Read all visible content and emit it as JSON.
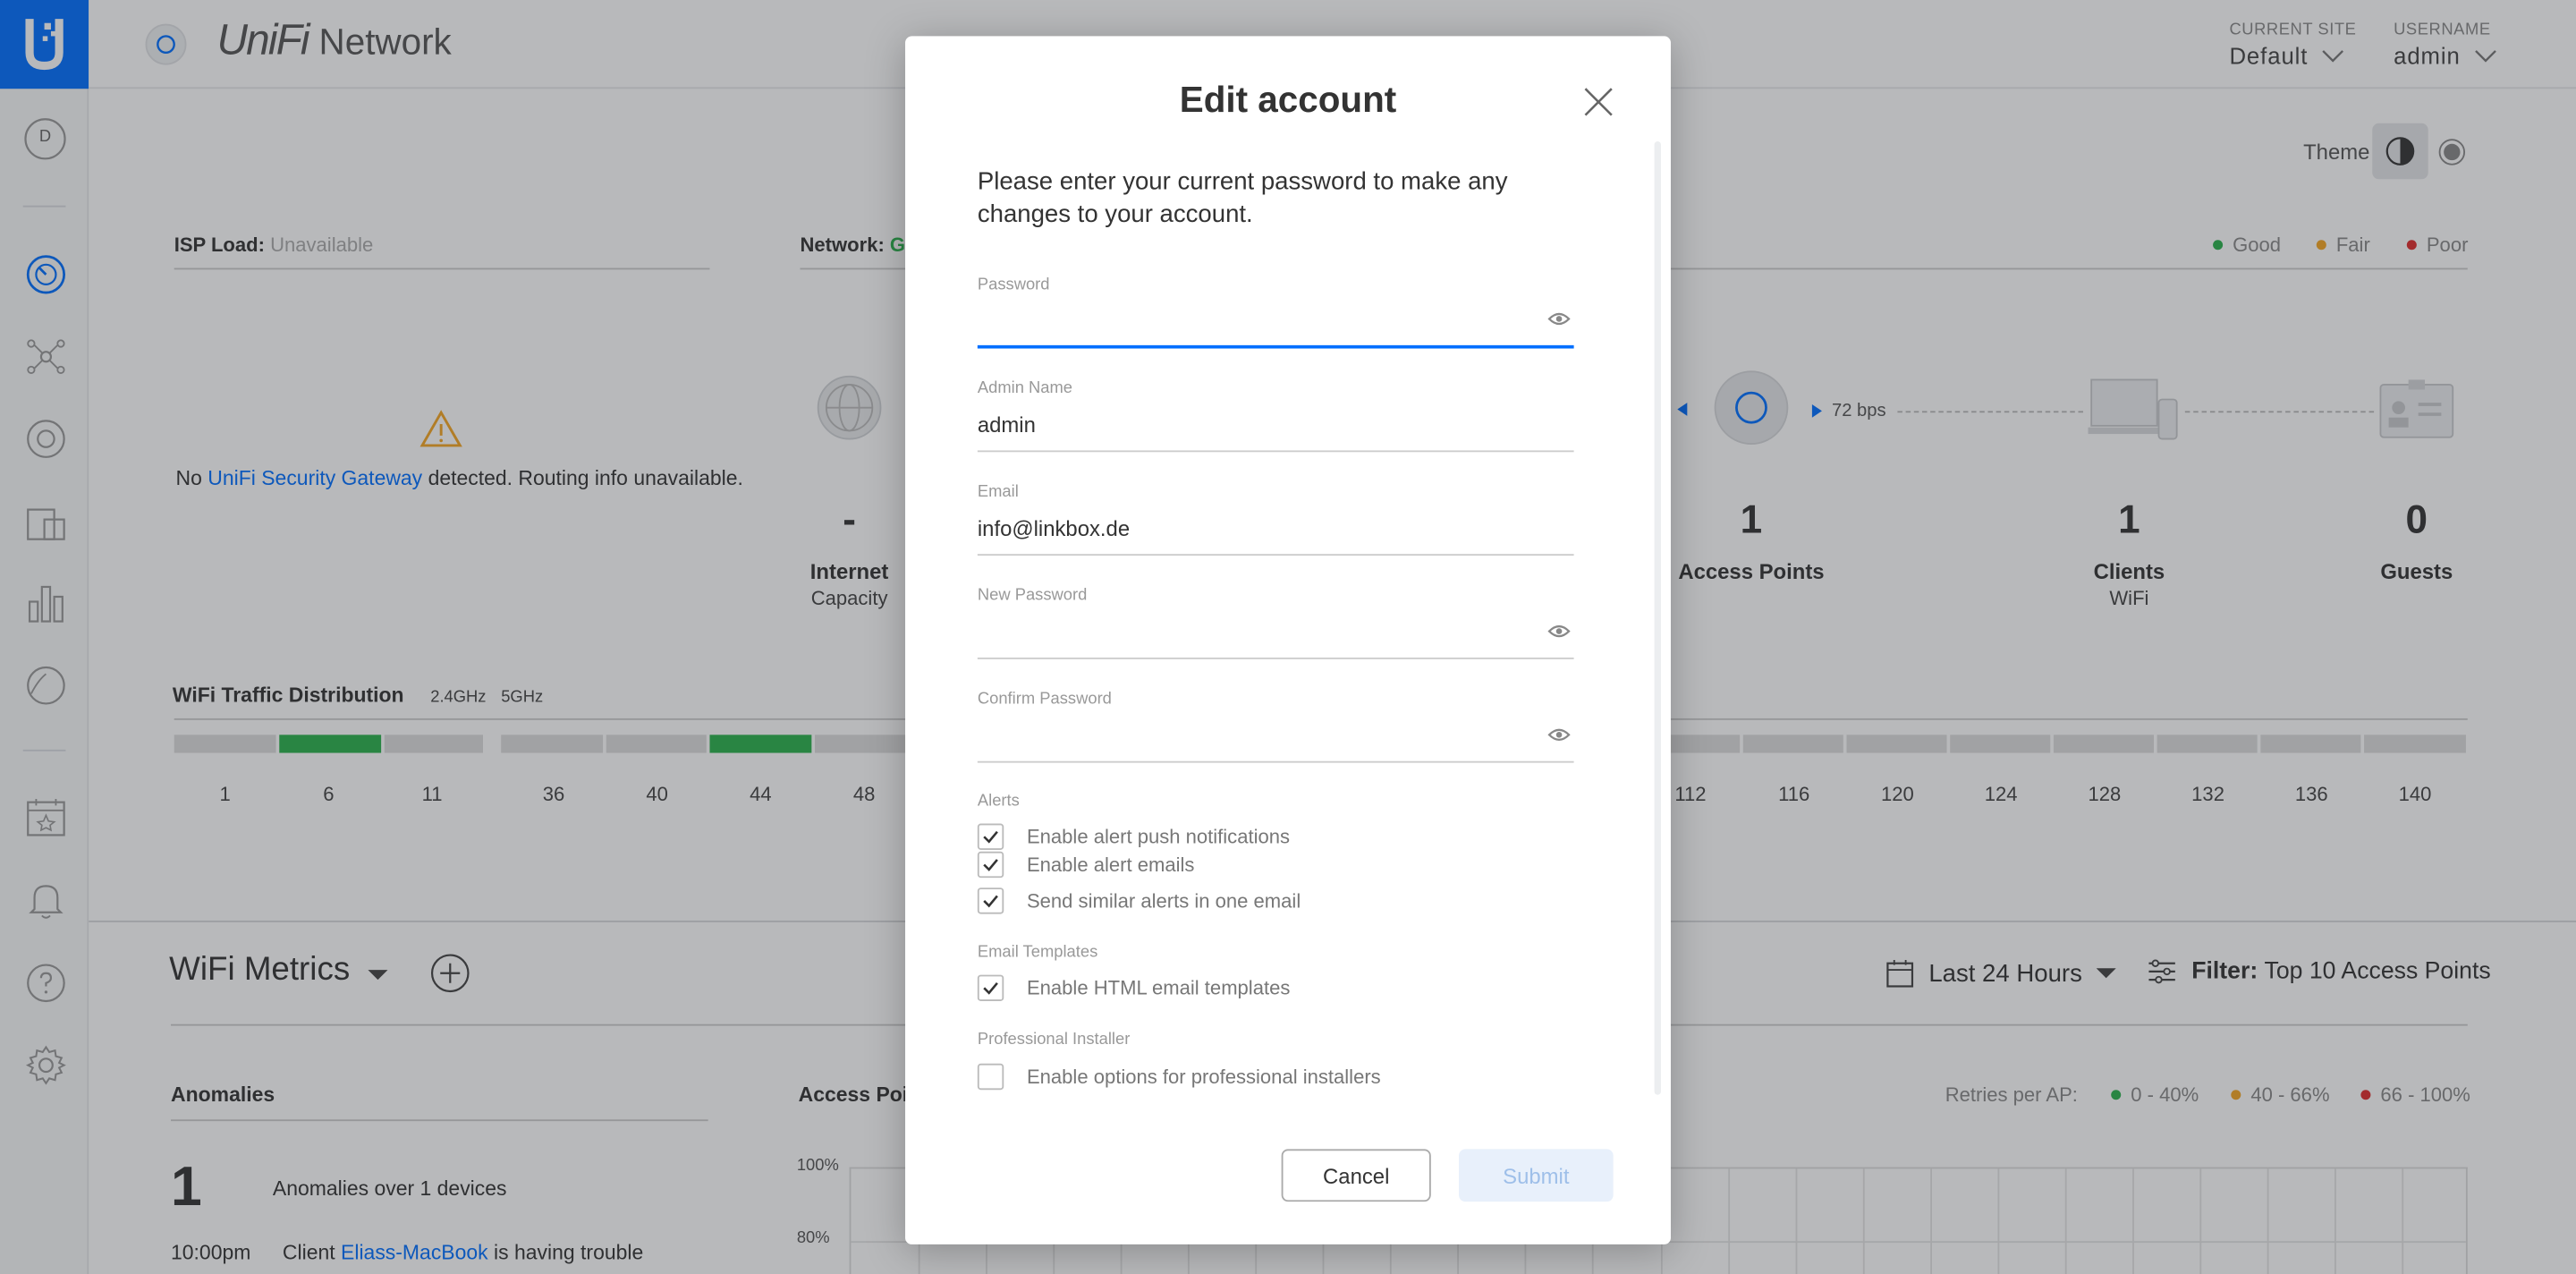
{
  "app": {
    "brand_ui": "UniFi",
    "brand_name": "Network"
  },
  "header": {
    "site_label": "CURRENT SITE",
    "site_value": "Default",
    "user_label": "USERNAME",
    "user_value": "admin"
  },
  "sidebar": {
    "avatar_letter": "D"
  },
  "dashboard": {
    "theme_label": "Theme",
    "isp_label": "ISP Load:",
    "isp_value": "Unavailable",
    "network_label": "Network:",
    "network_value": "Go",
    "legend_good": "Good",
    "legend_fair": "Fair",
    "legend_poor": "Poor",
    "warning_prefix": "No",
    "warning_link": "UniFi Security Gateway",
    "warning_suffix": "detected. Routing info unavailable.",
    "internet_value": "-",
    "internet_title": "Internet",
    "internet_sub": "Capacity",
    "ap_value": "1",
    "ap_title": "Access Points",
    "throughput": "72 bps",
    "clients_value": "1",
    "clients_title": "Clients",
    "clients_sub": "WiFi",
    "guests_value": "0",
    "guests_title": "Guests",
    "wifi_dist_label": "WiFi Traffic Distribution",
    "band_24": "2.4GHz",
    "band_5": "5GHz",
    "channels_24": [
      "1",
      "6",
      "11"
    ],
    "channels_5_left": [
      "36",
      "40",
      "44",
      "48"
    ],
    "channels_5_right": [
      "112",
      "116",
      "120",
      "124",
      "128",
      "132",
      "136",
      "140"
    ],
    "metrics_title": "WiFi Metrics",
    "range_label": "Last 24 Hours",
    "filter_label": "Filter:",
    "filter_value": "Top 10 Access Points",
    "anomalies_label": "Anomalies",
    "access_points_label": "Access Point",
    "retries_label": "Retries per AP:",
    "retry_good": "0 - 40%",
    "retry_fair": "40 - 66%",
    "retry_poor": "66 - 100%",
    "anomaly_count": "1",
    "anomaly_text": "Anomalies over 1 devices",
    "event_time": "10:00pm",
    "event_prefix": "Client",
    "event_link": "Eliass-MacBook",
    "event_suffix": "is having trouble",
    "axis_100": "100%",
    "axis_80": "80%"
  },
  "modal": {
    "title": "Edit account",
    "intro": "Please enter your current password to make any changes to your account.",
    "password_label": "Password",
    "admin_name_label": "Admin Name",
    "admin_name_value": "admin",
    "email_label": "Email",
    "email_value": "info@linkbox.de",
    "new_password_label": "New Password",
    "confirm_password_label": "Confirm Password",
    "alerts_label": "Alerts",
    "alert_push": "Enable alert push notifications",
    "alert_emails": "Enable alert emails",
    "alert_similar": "Send similar alerts in one email",
    "templates_label": "Email Templates",
    "templates_html": "Enable HTML email templates",
    "installer_label": "Professional Installer",
    "installer_options": "Enable options for professional installers",
    "cancel": "Cancel",
    "submit": "Submit"
  },
  "colors": {
    "accent": "#006fff",
    "good": "#2bb24c",
    "fair": "#f5a623",
    "poor": "#e02c2c"
  }
}
